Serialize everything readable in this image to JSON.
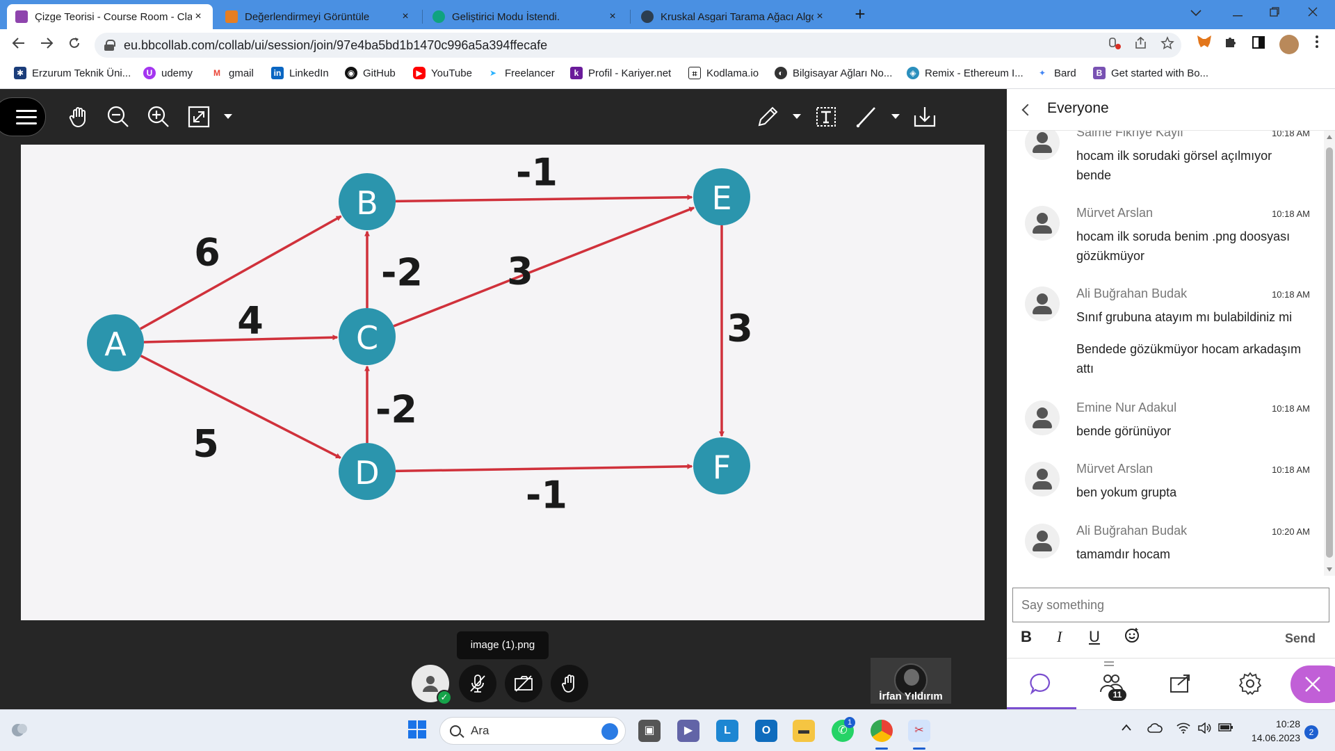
{
  "browser": {
    "tabs": [
      {
        "title": "Çizge Teorisi - Course Room - Cla",
        "close": "×",
        "color": "#8e44ad"
      },
      {
        "title": "Değerlendirmeyi Görüntüle",
        "close": "×",
        "color": "#e67e22"
      },
      {
        "title": "Geliştirici Modu İstendi.",
        "close": "×",
        "color": "#10a37f"
      },
      {
        "title": "Kruskal Asgari Tarama Ağacı Algo",
        "close": "×",
        "color": "#2c3e50"
      }
    ],
    "new_tab": "+",
    "url": "eu.bbcollab.com/collab/ui/session/join/97e4ba5bd1b1470c996a5a394ffecafe",
    "bookmarks": [
      {
        "label": "Erzurum Teknik Üni...",
        "icon": "snowflake-icon",
        "color": "#1b3d7a"
      },
      {
        "label": "udemy",
        "icon": "udemy-icon",
        "color": "#a435f0"
      },
      {
        "label": "gmail",
        "icon": "gmail-icon",
        "color": "#ea4335"
      },
      {
        "label": "LinkedIn",
        "icon": "linkedin-icon",
        "color": "#0a66c2"
      },
      {
        "label": "GitHub",
        "icon": "github-icon",
        "color": "#111111"
      },
      {
        "label": "YouTube",
        "icon": "youtube-icon",
        "color": "#ff0000"
      },
      {
        "label": "Freelancer",
        "icon": "freelancer-icon",
        "color": "#29b2fe"
      },
      {
        "label": "Profil - Kariyer.net",
        "icon": "kariyer-icon",
        "color": "#6a1b9a"
      },
      {
        "label": "Kodlama.io",
        "icon": "kodlama-icon",
        "color": "#222222"
      },
      {
        "label": "Bilgisayar Ağları No...",
        "icon": "globe-icon",
        "color": "#333333"
      },
      {
        "label": "Remix - Ethereum I...",
        "icon": "remix-icon",
        "color": "#2a8fbd"
      },
      {
        "label": "Bard",
        "icon": "bard-icon",
        "color": "#4285f4"
      },
      {
        "label": "Get started with Bo...",
        "icon": "bootstrap-icon",
        "color": "#7952b3"
      }
    ]
  },
  "whiteboard": {
    "node_color": "#2b95ad",
    "edge_color": "#d0313b",
    "nodes": [
      {
        "id": "A",
        "label": "A"
      },
      {
        "id": "B",
        "label": "B"
      },
      {
        "id": "C",
        "label": "C"
      },
      {
        "id": "D",
        "label": "D"
      },
      {
        "id": "E",
        "label": "E"
      },
      {
        "id": "F",
        "label": "F"
      }
    ],
    "edges": [
      {
        "from": "A",
        "to": "B",
        "weight": "6"
      },
      {
        "from": "A",
        "to": "C",
        "weight": "4"
      },
      {
        "from": "A",
        "to": "D",
        "weight": "5"
      },
      {
        "from": "C",
        "to": "B",
        "weight": "-2"
      },
      {
        "from": "D",
        "to": "C",
        "weight": "-2"
      },
      {
        "from": "B",
        "to": "E",
        "weight": "-1"
      },
      {
        "from": "C",
        "to": "E",
        "weight": "3"
      },
      {
        "from": "E",
        "to": "F",
        "weight": "3"
      },
      {
        "from": "D",
        "to": "F",
        "weight": "-1"
      }
    ],
    "file_name": "image (1).png"
  },
  "participant": {
    "name": "İrfan Yıldırım"
  },
  "chat": {
    "title": "Everyone",
    "messages": [
      {
        "author": "Saime Fikriye Kaylı",
        "time": "10:18 AM",
        "text": "hocam ilk sorudaki görsel açılmıyor bende"
      },
      {
        "author": "Mürvet Arslan",
        "time": "10:18 AM",
        "text": "hocam ilk soruda benim .png doosyası gözükmüyor"
      },
      {
        "author": "Ali Buğrahan Budak",
        "time": "10:18 AM",
        "text": "Sınıf grubuna atayım mı bulabildiniz mi"
      },
      {
        "author": "",
        "time": "",
        "text": "Bendede gözükmüyor hocam arkadaşım attı"
      },
      {
        "author": "Emine Nur Adakul",
        "time": "10:18 AM",
        "text": "bende görünüyor"
      },
      {
        "author": "Mürvet Arslan",
        "time": "10:18 AM",
        "text": "ben yokum grupta"
      },
      {
        "author": "Ali Buğrahan Budak",
        "time": "10:20 AM",
        "text": "tamamdır hocam"
      }
    ],
    "placeholder": "Say something",
    "format": {
      "bold": "B",
      "italic": "I",
      "underline": "U"
    },
    "send_label": "Send",
    "attendee_count": "11",
    "accent": "#7a4ecf"
  },
  "taskbar": {
    "search_placeholder": "Ara",
    "whatsapp_badge": "1",
    "time": "10:28",
    "date": "14.06.2023",
    "notifications": "2"
  }
}
